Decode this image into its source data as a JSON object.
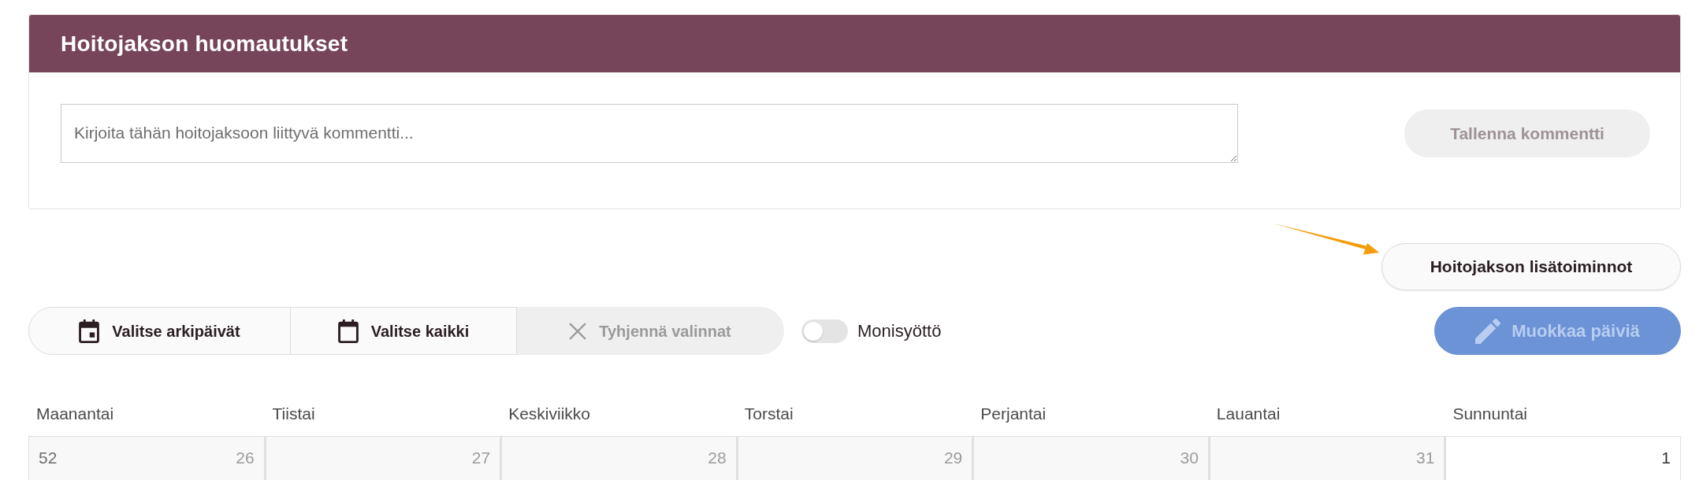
{
  "notes_panel": {
    "title": "Hoitojakson huomautukset",
    "comment_field": {
      "placeholder": "Kirjoita tähän hoitojaksoon liittyvä kommentti..."
    },
    "save_button": {
      "label": "Tallenna kommentti",
      "disabled": true
    }
  },
  "period_actions_button": {
    "label": "Hoitojakson lisätoiminnot"
  },
  "toolbar": {
    "selection_buttons": [
      {
        "kind": "weekdays",
        "label": "Valitse arkipäivät",
        "disabled": false
      },
      {
        "kind": "all",
        "label": "Valitse kaikki",
        "disabled": false
      },
      {
        "kind": "clear",
        "label": "Tyhjennä valinnat",
        "disabled": true
      }
    ],
    "multi_entry_toggle": {
      "label": "Monisyöttö",
      "on": false
    },
    "edit_days_button": {
      "label": "Muokkaa päiviä",
      "disabled": true
    }
  },
  "calendar": {
    "weekdays": [
      "Maanantai",
      "Tiistai",
      "Keskiviikko",
      "Torstai",
      "Perjantai",
      "Lauantai",
      "Sunnuntai"
    ],
    "weeks": [
      {
        "week_number": "52",
        "days": [
          {
            "date": "26",
            "disabled": true
          },
          {
            "date": "27",
            "disabled": true
          },
          {
            "date": "28",
            "disabled": true
          },
          {
            "date": "29",
            "disabled": true
          },
          {
            "date": "30",
            "disabled": true
          },
          {
            "date": "31",
            "disabled": true
          },
          {
            "date": "1",
            "disabled": false
          }
        ]
      }
    ]
  }
}
